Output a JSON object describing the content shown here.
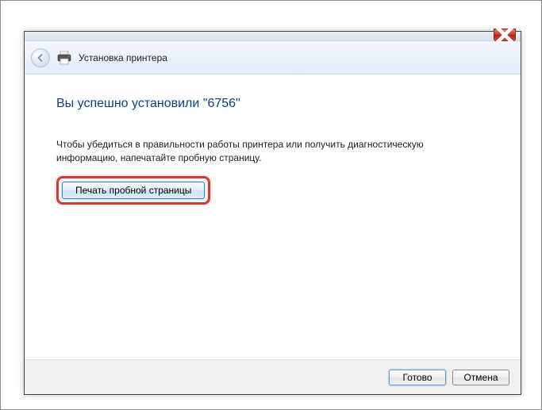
{
  "header": {
    "title": "Установка принтера"
  },
  "main": {
    "heading": "Вы успешно установили \"6756\"",
    "instruction": "Чтобы убедиться в правильности работы принтера или получить диагностическую информацию, напечатайте пробную страницу.",
    "test_button": "Печать пробной страницы"
  },
  "footer": {
    "finish": "Готово",
    "cancel": "Отмена"
  }
}
